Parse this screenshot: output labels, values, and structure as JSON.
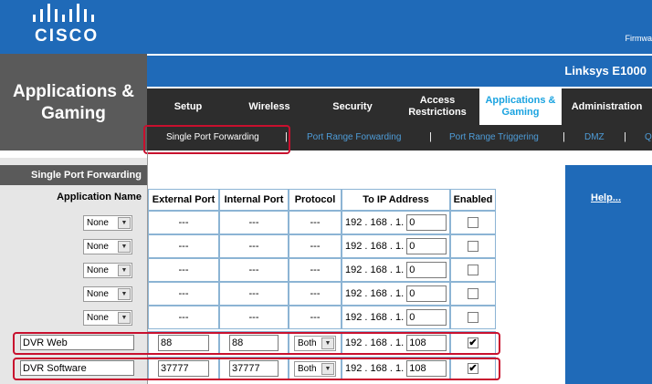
{
  "brand": {
    "logo_text": "CISCO",
    "firmware_label": "Firmwa",
    "model": "Linksys E1000"
  },
  "page_title": "Applications & Gaming",
  "nav": {
    "tabs": [
      {
        "label": "Setup"
      },
      {
        "label": "Wireless"
      },
      {
        "label": "Security"
      },
      {
        "label": "Access Restrictions"
      },
      {
        "label": "Applications & Gaming"
      },
      {
        "label": "Administration"
      }
    ]
  },
  "subnav": {
    "items": [
      {
        "label": "Single Port Forwarding"
      },
      {
        "label": "Port Range Forwarding"
      },
      {
        "label": "Port Range Triggering"
      },
      {
        "label": "DMZ"
      },
      {
        "label": "Q"
      }
    ],
    "separator": "|"
  },
  "section": {
    "heading": "Single Port Forwarding",
    "app_name_label": "Application Name",
    "help_link": "Help..."
  },
  "table": {
    "headers": [
      "External Port",
      "Internal Port",
      "Protocol",
      "To IP Address",
      "Enabled"
    ],
    "ip_prefix": "192 . 168 . 1.",
    "rows": [
      {
        "app": "None",
        "ext": "---",
        "int": "---",
        "proto": "---",
        "ip": "0",
        "enabled": false
      },
      {
        "app": "None",
        "ext": "---",
        "int": "---",
        "proto": "---",
        "ip": "0",
        "enabled": false
      },
      {
        "app": "None",
        "ext": "---",
        "int": "---",
        "proto": "---",
        "ip": "0",
        "enabled": false
      },
      {
        "app": "None",
        "ext": "---",
        "int": "---",
        "proto": "---",
        "ip": "0",
        "enabled": false
      },
      {
        "app": "None",
        "ext": "---",
        "int": "---",
        "proto": "---",
        "ip": "0",
        "enabled": false
      }
    ],
    "custom_rows": [
      {
        "app": "DVR Web",
        "ext": "88",
        "int": "88",
        "proto": "Both",
        "ip": "108",
        "enabled": true
      },
      {
        "app": "DVR Software",
        "ext": "37777",
        "int": "37777",
        "proto": "Both",
        "ip": "108",
        "enabled": true
      }
    ]
  },
  "checkmark": "✔",
  "arrow_glyph": "▼",
  "colors": {
    "banner_blue": "#1f6ab8",
    "accent_cyan": "#1aa3e0",
    "highlight_red": "#c8102e"
  }
}
